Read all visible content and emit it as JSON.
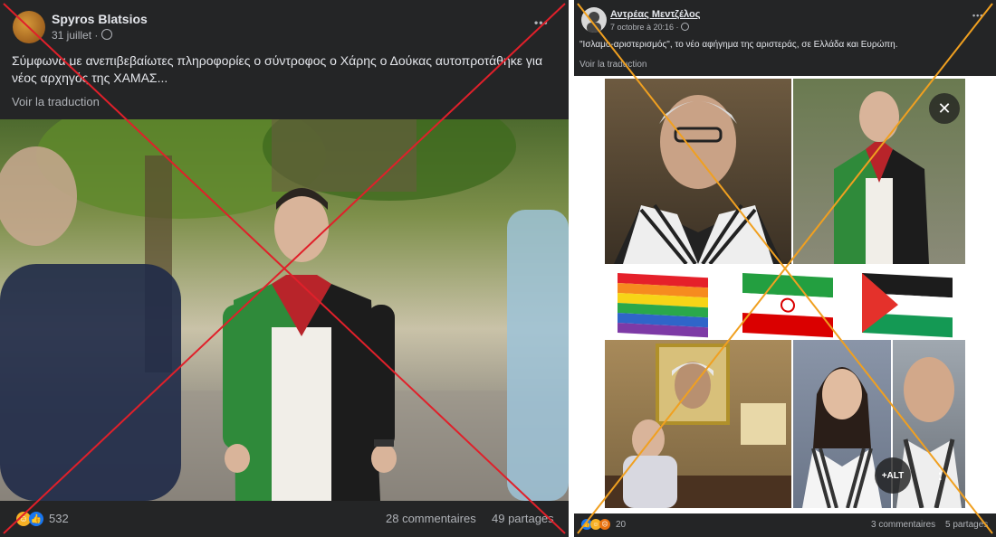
{
  "left_post": {
    "author": "Spyros Blatsios",
    "date": "31 juillet",
    "text": "Σύμφωνα με ανεπιβεβαίωτες πληροφορίες ο σύντροφος ο Χάρης ο Δούκας αυτοπροτάθηκε για νέος αρχηγός της ΧΑΜΑΣ...",
    "translate": "Voir la traduction",
    "reactions_count": "532",
    "comments": "28 commentaires",
    "shares": "49 partages",
    "more": "•••",
    "cross_color": "#e0202a"
  },
  "right_post": {
    "author": "Αντρέας Μεντζέλος",
    "date": "7 octobre à 20:16 ·",
    "text": "\"Ισλαμο-αριστερισμός\", το νέο αφήγημα της αριστεράς, σε Ελλάδα και Ευρώπη.",
    "translate": "Voir la traduction",
    "reactions_count": "20",
    "comments": "3 commentaires",
    "shares": "5 partages",
    "more": "•••",
    "alt_label": "+ALT",
    "close_glyph": "✕",
    "cross_color": "#f0a020"
  },
  "colors": {
    "fb_dark": "#242526",
    "text_light": "#e4e6eb",
    "text_muted": "#b0b3b8",
    "like_blue": "#1877f2",
    "haha_yellow": "#f7b125"
  }
}
